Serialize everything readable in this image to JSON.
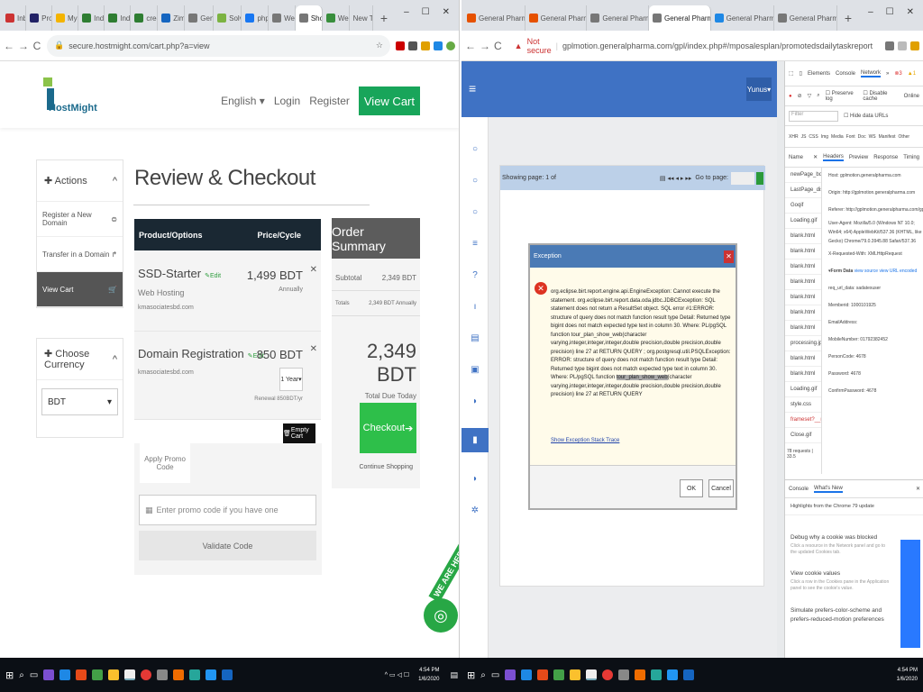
{
  "left_browser": {
    "tabs": [
      "Inbox",
      "Profile",
      "My Dri",
      "Individ",
      "Individ",
      "creden",
      "Zimbra",
      "Generic",
      "Solve F",
      "phpMy",
      "Web H",
      "Sho",
      "Web H",
      "New Tab"
    ],
    "url": "secure.hostmight.com/cart.php?a=view",
    "win_controls": [
      "–",
      "☐",
      "✕"
    ]
  },
  "hostmight": {
    "logo_text": "HostMight",
    "nav": {
      "language": "English",
      "login": "Login",
      "register": "Register",
      "view_cart": "View Cart"
    },
    "actions": {
      "title": "Actions",
      "items": [
        "Register a New Domain",
        "Transfer in a Domain",
        "View Cart"
      ]
    },
    "currency": {
      "title": "Choose Currency",
      "selected": "BDT"
    },
    "page_title": "Review & Checkout",
    "cart": {
      "col_product": "Product/Options",
      "col_price": "Price/Cycle",
      "items": [
        {
          "name": "SSD-Starter",
          "edit": "Edit",
          "group": "Web Hosting",
          "domain": "kmasociatesbd.com",
          "price": "1,499 BDT",
          "cycle": "Annually"
        },
        {
          "name": "Domain Registration",
          "edit": "Edit",
          "domain": "kmasociatesbd.com",
          "price": "850 BDT",
          "period": "1 Year",
          "renewal": "Renewal 850BDT/yr"
        }
      ],
      "empty_cart": "Empty Cart"
    },
    "promo": {
      "tab": "Apply Promo Code",
      "placeholder": "Enter promo code if you have one",
      "button": "Validate Code"
    },
    "summary": {
      "title": "Order Summary",
      "subtotal_label": "Subtotal",
      "subtotal": "2,349 BDT",
      "totals_label": "Totals",
      "totals": "2,349 BDT Annually",
      "total_due": "2,349 BDT",
      "total_due_label": "Total Due Today",
      "checkout": "Checkout",
      "continue": "Continue Shopping"
    },
    "badge_text": "WE ARE HERE!"
  },
  "right_browser": {
    "tabs": [
      "General Pharma Admin",
      "General Pharma Admin",
      "General Pharma Admin",
      "General Pharma Admin",
      "General Pharmaceutical",
      "General Pharmaceutical"
    ],
    "not_secure": "Not secure",
    "url": "gplmotion.generalpharma.com/gpl/index.php#/mposalesplan/promotedsdailytaskreport",
    "win_controls": [
      "–",
      "☐",
      "✕"
    ]
  },
  "gpl": {
    "user": "Yunus",
    "paging": {
      "showing": "Showing page: 1 of",
      "goto": "Go to page:"
    },
    "dialog": {
      "title": "Exception",
      "message": "org.eclipse.birt.report.engine.api.EngineException: Cannot execute the statement. org.eclipse.birt.report.data.oda.jdbc.JDBCException: SQL statement does not return a ResultSet object. SQL error #1:ERROR: structure of query does not match function result type Detail: Returned type bigint does not match expected type text in column 30. Where: PL/pgSQL function tour_plan_show_web(character varying,integer,integer,integer,double precision,double precision,double precision) line 27 at RETURN QUERY ; org.postgresql.util.PSQLException: ERROR: structure of query does not match function result type Detail: Returned type bigint does not match expected type text in column 30. Where: PL/pgSQL function",
      "highlight": "tour_plan_show_web",
      "message_tail": "(character varying,integer,integer,integer,double precision,double precision,double precision) line 27 at RETURN QUERY",
      "link": "Show Exception Stack Trace",
      "ok": "OK",
      "cancel": "Cancel"
    }
  },
  "devtools": {
    "tabs": [
      "Elements",
      "Console",
      "Network",
      "»"
    ],
    "errors": "3",
    "warnings": "1",
    "preserve_log": "Preserve log",
    "disable_cache": "Disable cache",
    "online": "Online",
    "filter": "Filter",
    "hide_urls": "Hide data URLs",
    "types": [
      "XHR",
      "JS",
      "CSS",
      "Img",
      "Media",
      "Font",
      "Doc",
      "WS",
      "Manifest",
      "Other"
    ],
    "col_name": "Name",
    "sub_tabs": [
      "Headers",
      "Preview",
      "Response",
      "Timing"
    ],
    "requests": [
      "newPage_bdt",
      "LastPage_disab",
      "Goqif",
      "Loading.gif",
      "blank.html",
      "blank.html",
      "blank.html",
      "blank.html",
      "blank.html",
      "blank.html",
      "blank.html",
      "processing.jpg",
      "blank.html",
      "blank.html",
      "Loading.gif",
      "style.css",
      "frameset?__rep",
      "Close.gif"
    ],
    "request_count": "78 requests",
    "request_size": "33.5",
    "headers": [
      "Host: gplmotion.generalpharma.com",
      "Origin: http://gplmotion.generalpharma.com",
      "Referer: http://gplmotion.generalpharma.com/gpl/index.php",
      "User-Agent: Mozilla/5.0 (Windows NT 10.0; Win64; x64) AppleWebKit/537.36 (KHTML, like Gecko) Chrome/79.0.3945.88 Safari/537.36",
      "X-Requested-With: XMLHttpRequest"
    ],
    "form_data_title": "Form Data",
    "view_source": "view source",
    "view_url": "view URL encoded",
    "form": [
      "req_url_data: sadatexuser",
      "Memberid: 1000101925",
      "EmailAddress:",
      "MobileNumber: 01792382452",
      "PersonCode: 4678",
      "Password: 4678",
      "ConfirmPassword: 4678"
    ],
    "drawer_tabs": [
      "Console",
      "What's New"
    ],
    "whatsnew_title": "Highlights from the Chrome 79 update",
    "news": [
      {
        "title": "Debug why a cookie was blocked",
        "desc": "Click a resource in the Network panel and go to the updated Cookies tab."
      },
      {
        "title": "View cookie values",
        "desc": "Click a row in the Cookies pane in the Application panel to see the cookie's value."
      },
      {
        "title": "Simulate prefers-color-scheme and prefers-reduced-motion preferences",
        "desc": ""
      }
    ]
  },
  "taskbar": {
    "left_time": "4:54 PM",
    "left_date": "1/6/2020",
    "right_time": "4:54 PM",
    "right_date": "1/6/2020"
  }
}
